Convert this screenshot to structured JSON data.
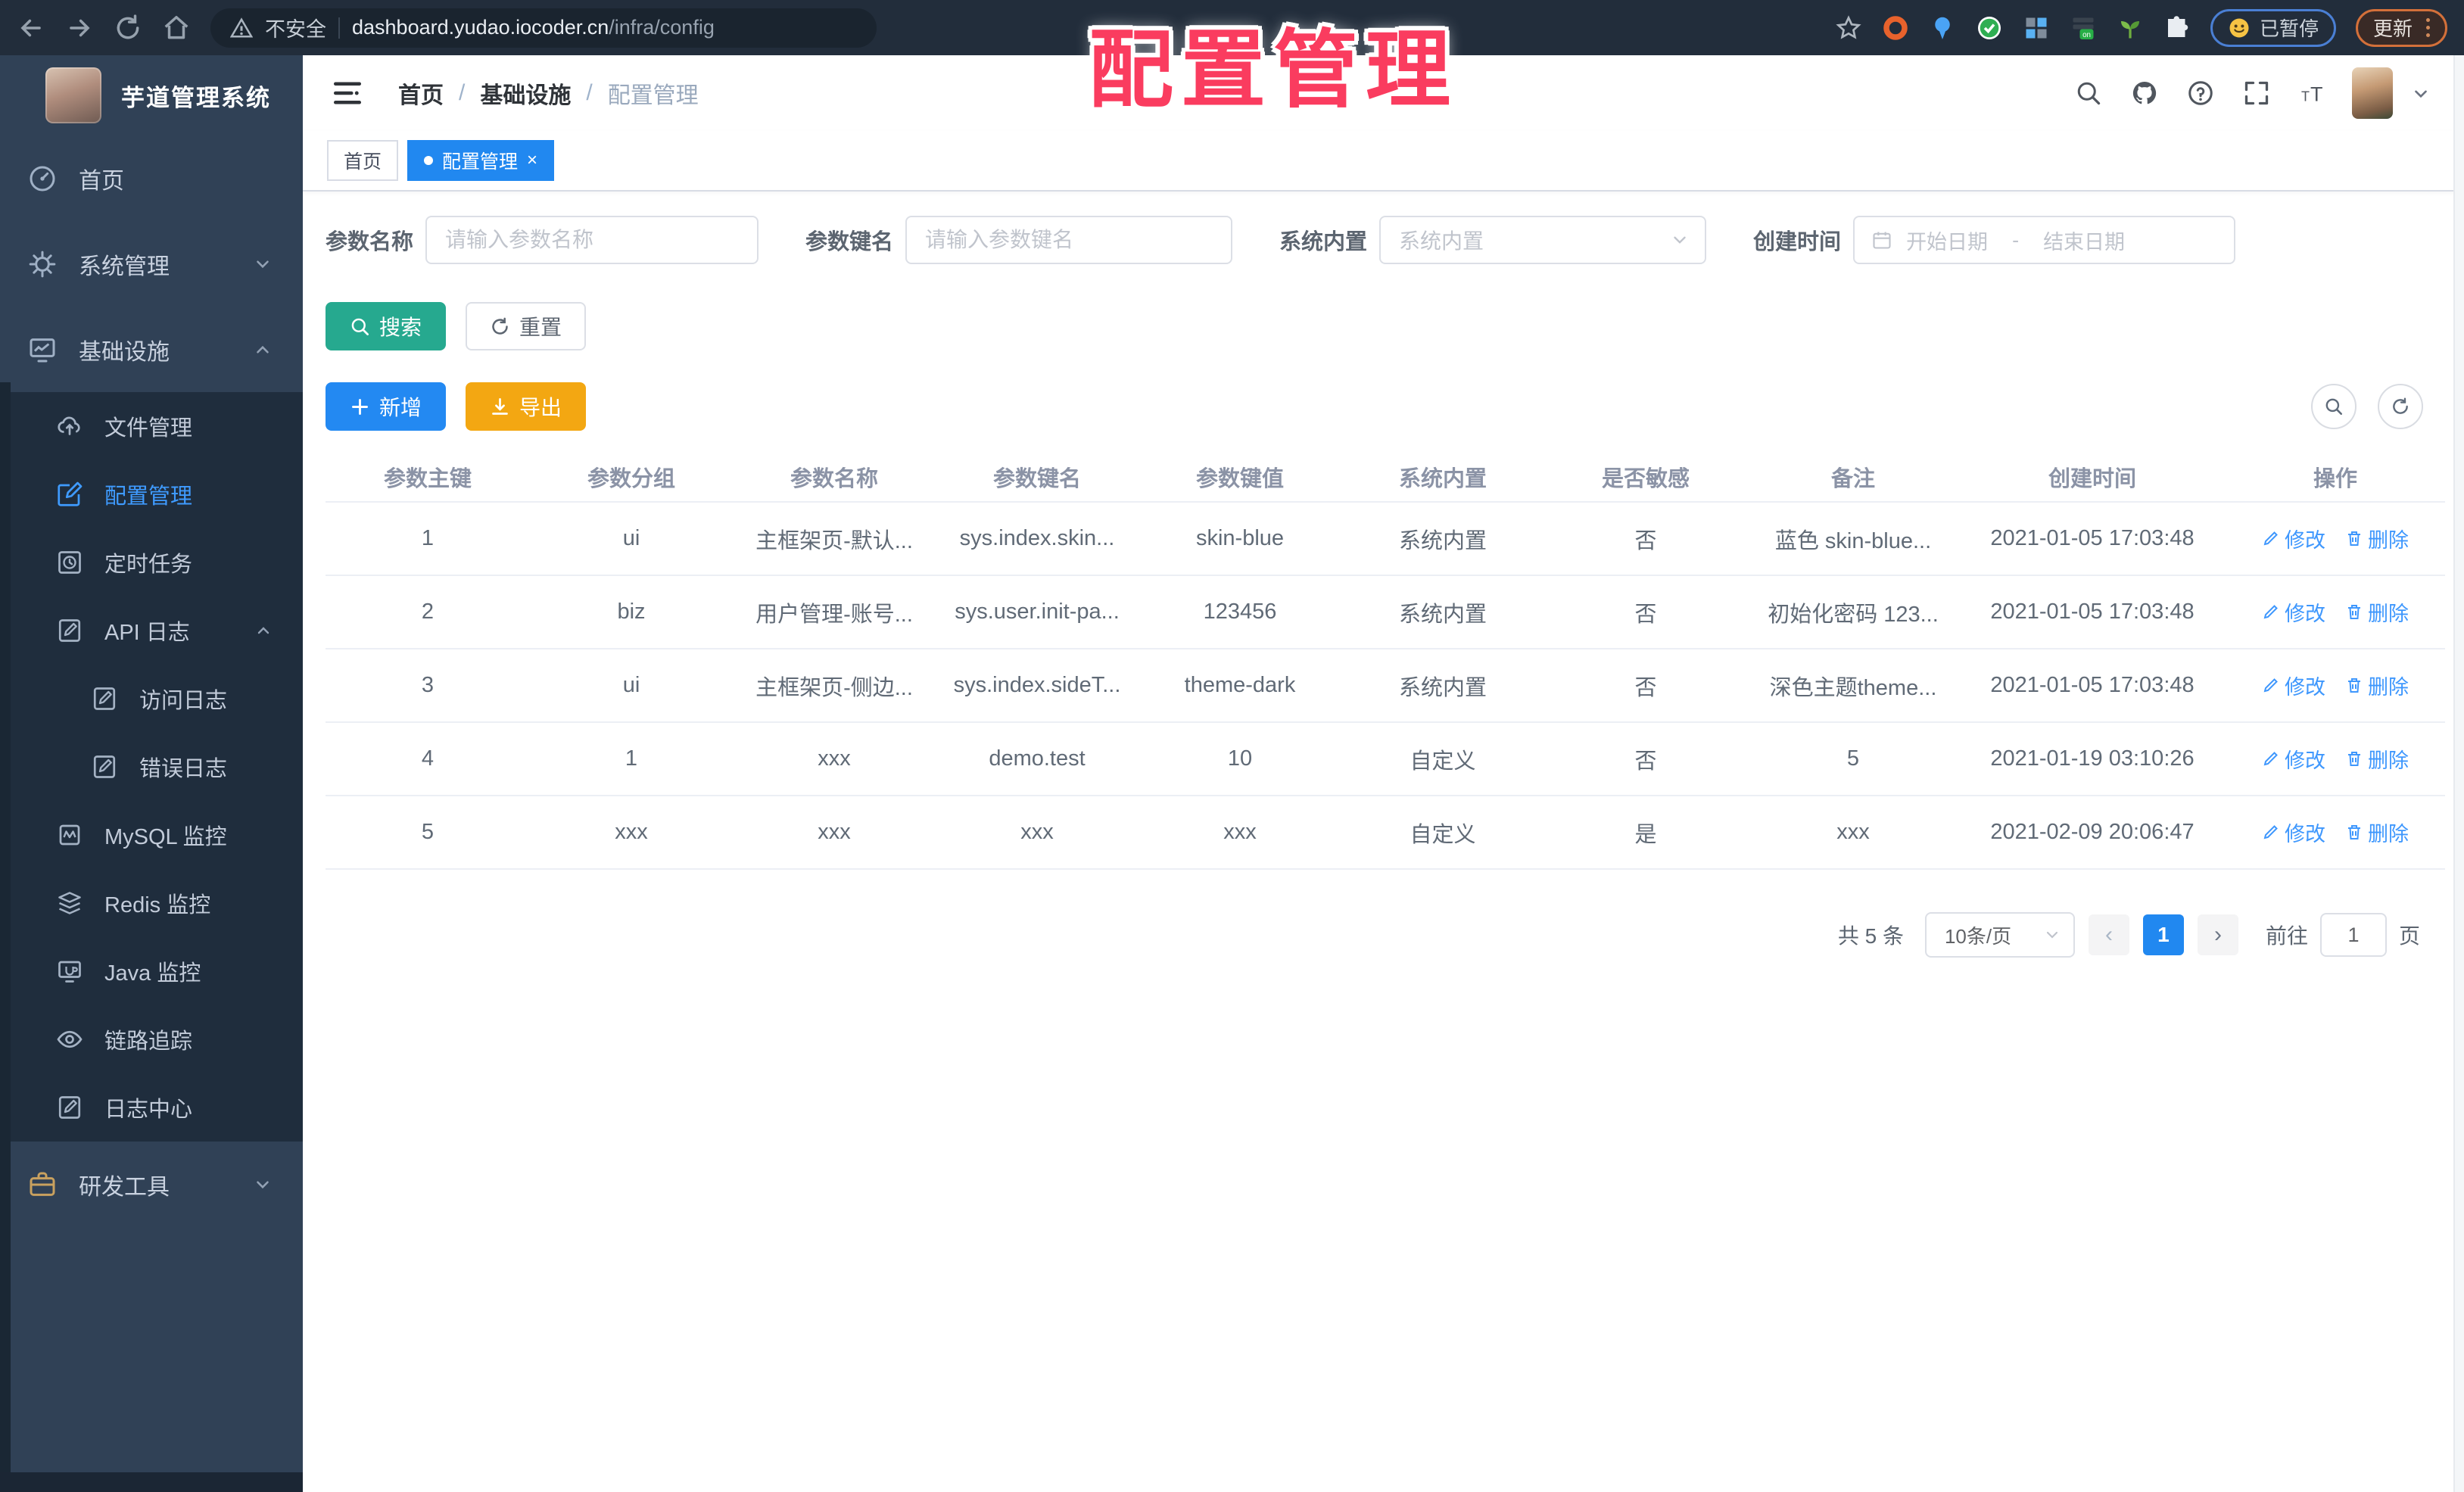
{
  "browser": {
    "security": "不安全",
    "url_host": "dashboard.yudao.iocoder.cn",
    "url_path": "/infra/config",
    "paused_label": "已暂停",
    "update_label": "更新"
  },
  "overlay": {
    "title": "配置管理"
  },
  "sidebar": {
    "app_title": "芋道管理系统",
    "menu_home": "首页",
    "menu_system": "系统管理",
    "menu_infra": "基础设施",
    "sub_file": "文件管理",
    "sub_config": "配置管理",
    "sub_job": "定时任务",
    "sub_api_log": "API 日志",
    "sub_access_log": "访问日志",
    "sub_error_log": "错误日志",
    "sub_mysql": "MySQL 监控",
    "sub_redis": "Redis 监控",
    "sub_java": "Java 监控",
    "sub_trace": "链路追踪",
    "sub_log_center": "日志中心",
    "menu_dev": "研发工具"
  },
  "header": {
    "breadcrumb": [
      "首页",
      "基础设施",
      "配置管理"
    ],
    "separator": "/"
  },
  "tabs": {
    "home": "首页",
    "active": "配置管理",
    "close": "×"
  },
  "form": {
    "name_label": "参数名称",
    "name_placeholder": "请输入参数名称",
    "key_label": "参数键名",
    "key_placeholder": "请输入参数键名",
    "type_label": "系统内置",
    "type_placeholder": "系统内置",
    "date_label": "创建时间",
    "date_start": "开始日期",
    "date_sep": "-",
    "date_end": "结束日期",
    "search_label": "搜索",
    "reset_label": "重置",
    "add_label": "新增",
    "export_label": "导出"
  },
  "table": {
    "headers": [
      "参数主键",
      "参数分组",
      "参数名称",
      "参数键名",
      "参数键值",
      "系统内置",
      "是否敏感",
      "备注",
      "创建时间",
      "操作"
    ],
    "edit_label": "修改",
    "delete_label": "删除",
    "rows": [
      {
        "id": "1",
        "group": "ui",
        "name": "主框架页-默认...",
        "key": "sys.index.skin...",
        "value": "skin-blue",
        "type": "系统内置",
        "sensitive": "否",
        "remark": "蓝色 skin-blue...",
        "created": "2021-01-05 17:03:48"
      },
      {
        "id": "2",
        "group": "biz",
        "name": "用户管理-账号...",
        "key": "sys.user.init-pa...",
        "value": "123456",
        "type": "系统内置",
        "sensitive": "否",
        "remark": "初始化密码 123...",
        "created": "2021-01-05 17:03:48"
      },
      {
        "id": "3",
        "group": "ui",
        "name": "主框架页-侧边...",
        "key": "sys.index.sideT...",
        "value": "theme-dark",
        "type": "系统内置",
        "sensitive": "否",
        "remark": "深色主题theme...",
        "created": "2021-01-05 17:03:48"
      },
      {
        "id": "4",
        "group": "1",
        "name": "xxx",
        "key": "demo.test",
        "value": "10",
        "type": "自定义",
        "sensitive": "否",
        "remark": "5",
        "created": "2021-01-19 03:10:26"
      },
      {
        "id": "5",
        "group": "xxx",
        "name": "xxx",
        "key": "xxx",
        "value": "xxx",
        "type": "自定义",
        "sensitive": "是",
        "remark": "xxx",
        "created": "2021-02-09 20:06:47"
      }
    ]
  },
  "pagination": {
    "total": "共 5 条",
    "page_size": "10条/页",
    "current": "1",
    "goto_label": "前往",
    "goto_value": "1",
    "unit": "页"
  },
  "icons": {
    "search": "magnifier",
    "github": "octocat",
    "help": "question-circle",
    "fullscreen": "expand",
    "font_size": "tT",
    "refresh": "circular-arrow",
    "add": "plus",
    "export": "download",
    "edit": "pencil",
    "delete": "trash",
    "warning": "triangle-exclamation"
  },
  "colors": {
    "accent": "#2188f0",
    "success": "#26a98f",
    "warning": "#f3a712",
    "overlay": "#fa3c5f",
    "sidebar": "#304156",
    "submenu": "#1f2d3d"
  }
}
